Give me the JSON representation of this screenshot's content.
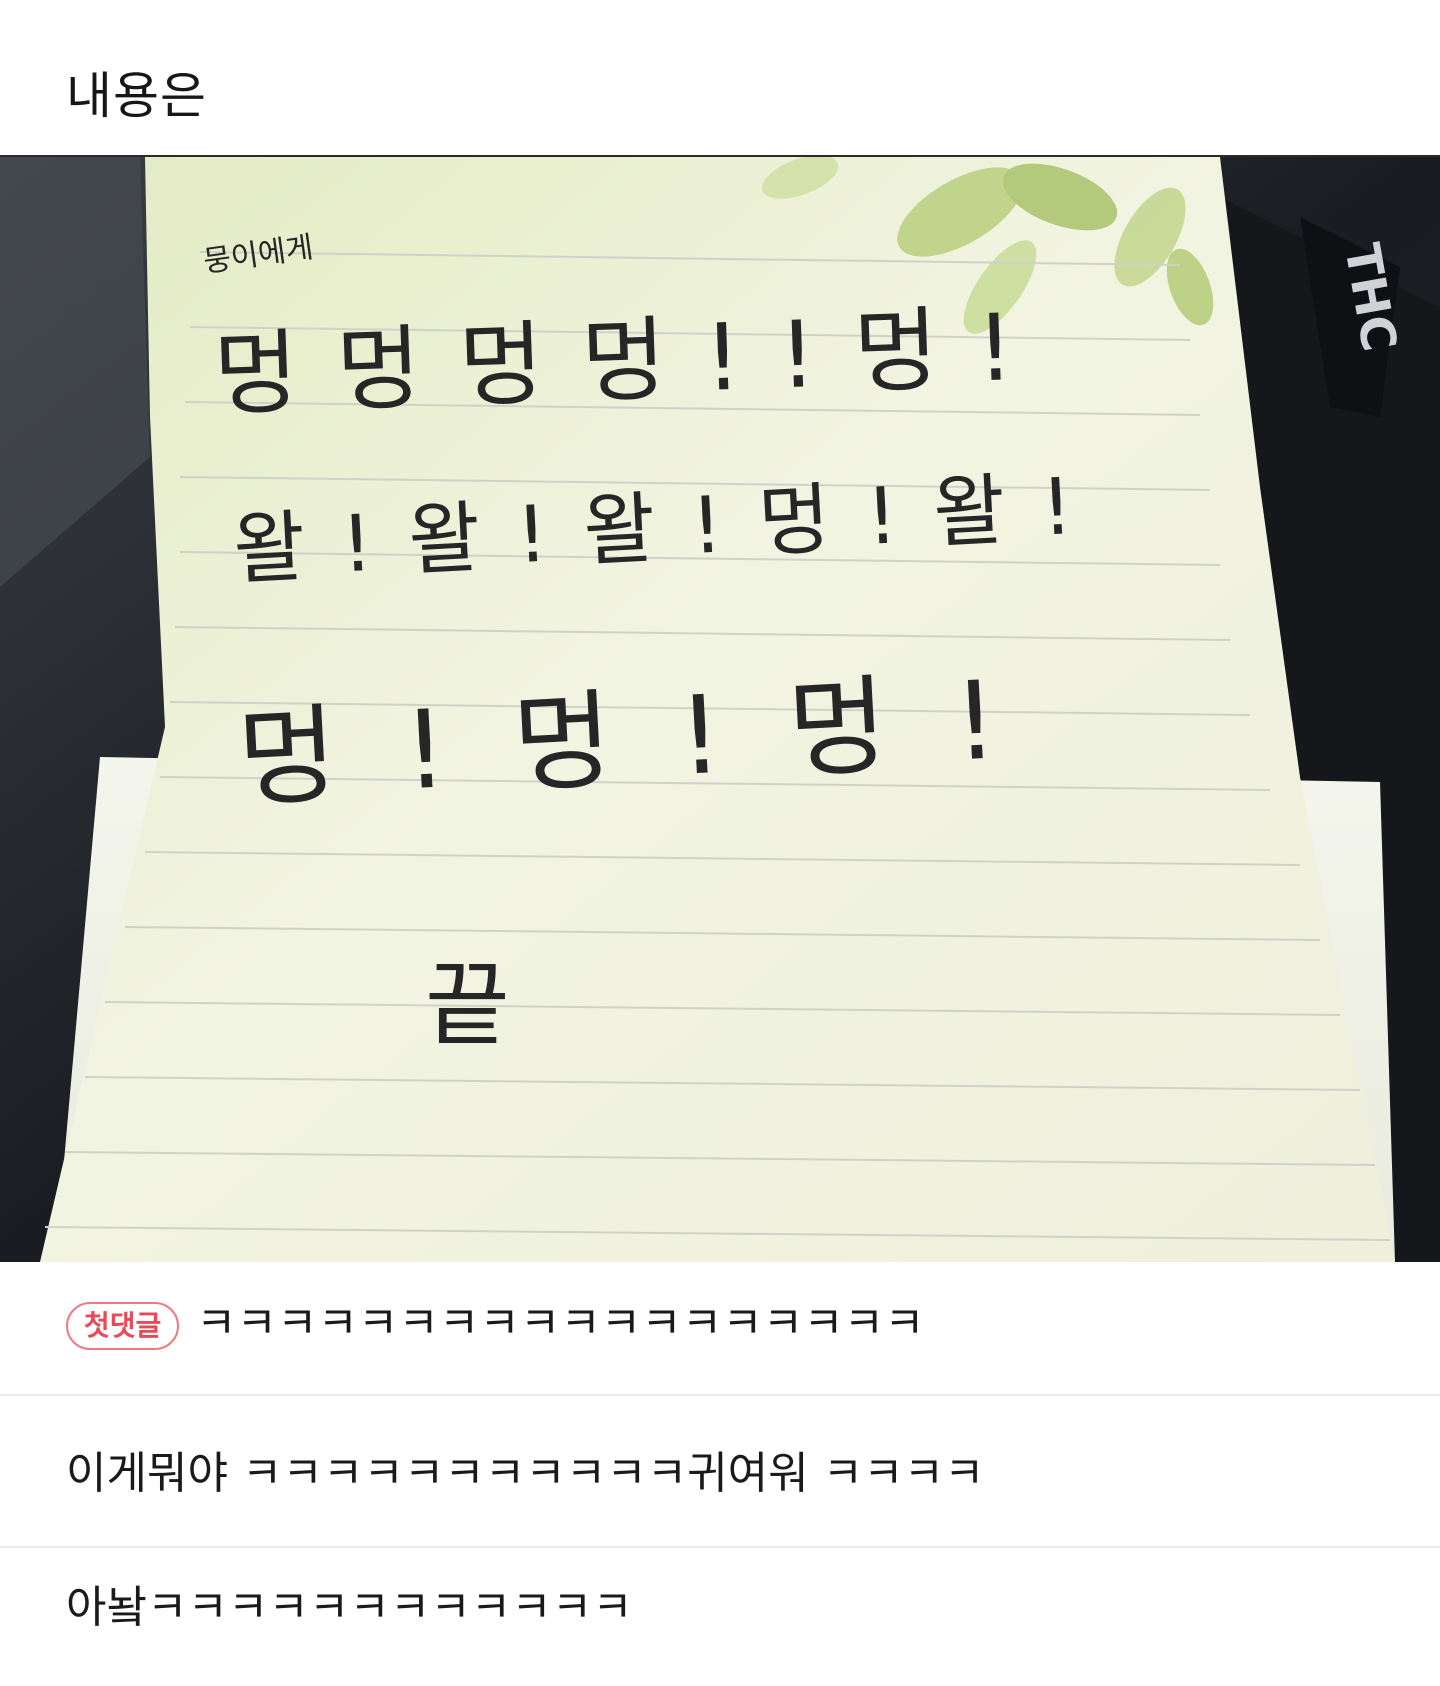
{
  "post": {
    "title": "내용은"
  },
  "photo": {
    "note_small": "뭉이에게",
    "line1": "멍멍멍멍!!멍!",
    "line2": "왈!왈!왈!멍!왈!",
    "line3": "멍!멍!멍!",
    "line4": "끝"
  },
  "comments": [
    {
      "badge": "첫댓글",
      "text": "ㅋㅋㅋㅋㅋㅋㅋㅋㅋㅋㅋㅋㅋㅋㅋㅋㅋㅋ"
    },
    {
      "text": "이게뭐야 ㅋㅋㅋㅋㅋㅋㅋㅋㅋㅋㅋ귀여워 ㅋㅋㅋㅋ"
    },
    {
      "text": "아놬ㅋㅋㅋㅋㅋㅋㅋㅋㅋㅋㅋㅋ"
    }
  ],
  "colors": {
    "badge": "#e94a58",
    "divider": "#ececec",
    "paper": "#f3f4e4",
    "paper_green": "#d9e6b0"
  }
}
